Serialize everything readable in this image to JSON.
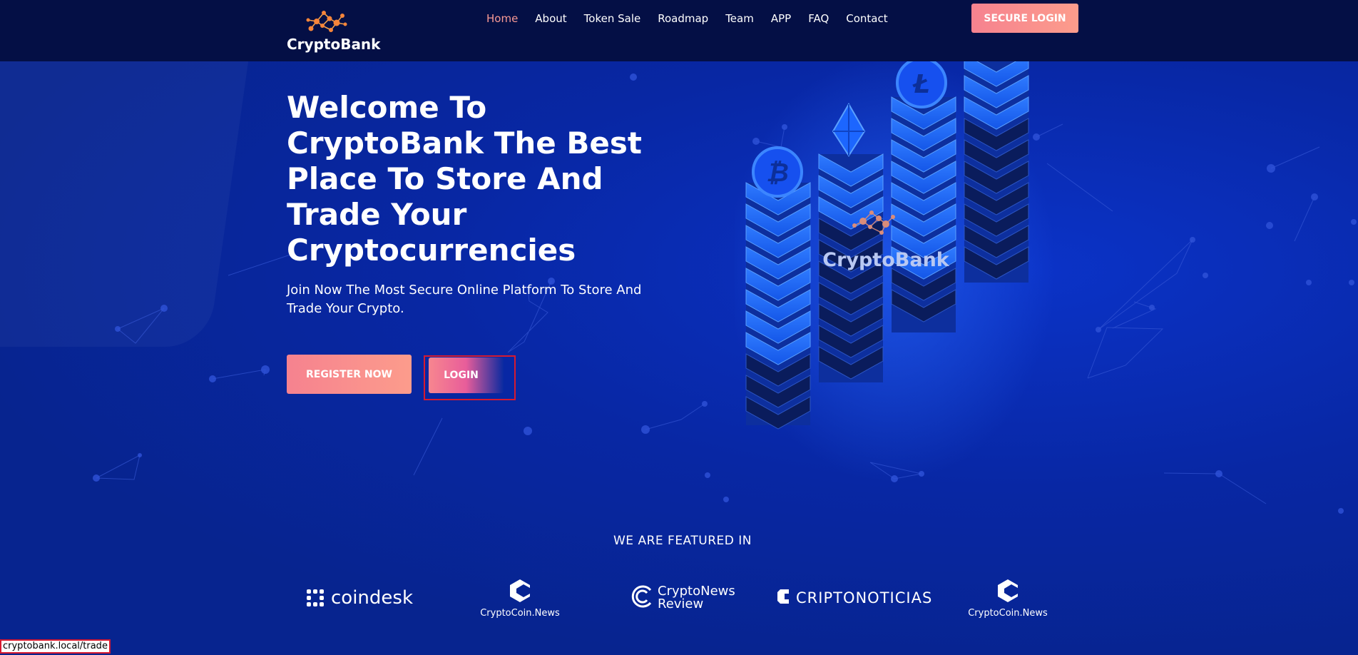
{
  "brand": {
    "name": "CryptoBank"
  },
  "nav": {
    "items": [
      {
        "label": "Home",
        "active": true
      },
      {
        "label": "About"
      },
      {
        "label": "Token Sale"
      },
      {
        "label": "Roadmap"
      },
      {
        "label": "Team"
      },
      {
        "label": "APP"
      },
      {
        "label": "FAQ"
      },
      {
        "label": "Contact"
      }
    ],
    "secure_login": "SECURE LOGIN"
  },
  "hero": {
    "headline": "Welcome To CryptoBank The Best Place To Store And Trade Your Cryptocurrencies",
    "subtext": "Join Now The Most Secure Online Platform To Store And Trade Your Crypto.",
    "register_label": "REGISTER NOW",
    "login_label": "LOGIN",
    "illustration_brand": "CryptoBank"
  },
  "featured": {
    "title": "WE ARE FEATURED IN",
    "partners": [
      {
        "name": "coindesk",
        "icon": "coindesk-icon"
      },
      {
        "name": "CryptoCoin.News",
        "icon": "cryptocoin-news-icon"
      },
      {
        "name": "CryptoNews Review",
        "icon": "cryptonews-review-icon"
      },
      {
        "name": "CRIPTONOTICIAS",
        "icon": "criptonoticias-icon"
      },
      {
        "name": "CryptoCoin.News",
        "icon": "cryptocoin-news-icon"
      }
    ]
  },
  "status_bar": {
    "url": "cryptobank.local/trade"
  },
  "colors": {
    "header_bg": "#040f45",
    "hero_bg": "#07248f",
    "accent": "#f6828f",
    "active_nav": "#f89a94"
  }
}
